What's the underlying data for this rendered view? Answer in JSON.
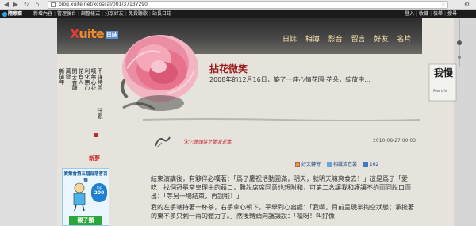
{
  "browser": {
    "url": "blog.xuite.net/xcoscal/001/37137290",
    "back": "◀",
    "forward": "▶",
    "reload": "↻",
    "home": "⌂"
  },
  "topnav": {
    "logo": "隨意窩",
    "left": [
      "新增內容",
      "管理後台",
      "調整樣式",
      "分享好友",
      "免費聽歌",
      "站長日誌"
    ],
    "right": [
      "登入",
      "收藏",
      "檢舉",
      "搜尋"
    ]
  },
  "brand": {
    "logo_x": "X",
    "logo_rest": "uite",
    "logo_diary": "日誌"
  },
  "menu": [
    "日誌",
    "相簿",
    "影音",
    "留言",
    "好友",
    "名片"
  ],
  "blog": {
    "title": "拈花微笑",
    "subtitle": "2008年的12月16日，築了一座心情花園‧花朵，綻放中..."
  },
  "calligraphy": {
    "cols": [
      "不謀時間",
      "嘆無心花",
      "利化無心",
      "花有人",
      "閒夫香靜",
      "萬發一",
      "新瑜年"
    ],
    "signature": "仟觀"
  },
  "post": {
    "title": "沈它蓬頭髮之艷波逝漾",
    "date": "2010-08-27 00:03",
    "actions": [
      "好文轉寄",
      "相識流它裳",
      "162"
    ],
    "body": [
      "結束演講後，有夥伴必嘆著：「爲了慶祝活動圓滿，明天，就明天嘛爽食去！」這是爲了「愛吃」找個冠冕堂皇理由的藉口，難說席席同意也想附和，可第二念讓我和護讓不約而同脫口而出：「等另一場結束，再說啦！」",
      "我的左手端持著一杯茶，右手拿心朝下，平舉到心窩處：「我啊，目前呈現半掏空狀態；承擔著的東不多只剩一兩的體力了。」然後轉頭向護讓說：「嘆呀！叫好像"
    ]
  },
  "sidebar": {
    "new_label": "新夢",
    "widget_title": "資策會第五屆部落客百傑",
    "badge_top": "Top",
    "badge_num": "200",
    "tag": "親子類"
  },
  "right_sidebar": {
    "nav": [
      "登入",
      "收藏",
      "檢舉"
    ],
    "banner_text": "我慢",
    "banner_sub": "Poor Life"
  }
}
